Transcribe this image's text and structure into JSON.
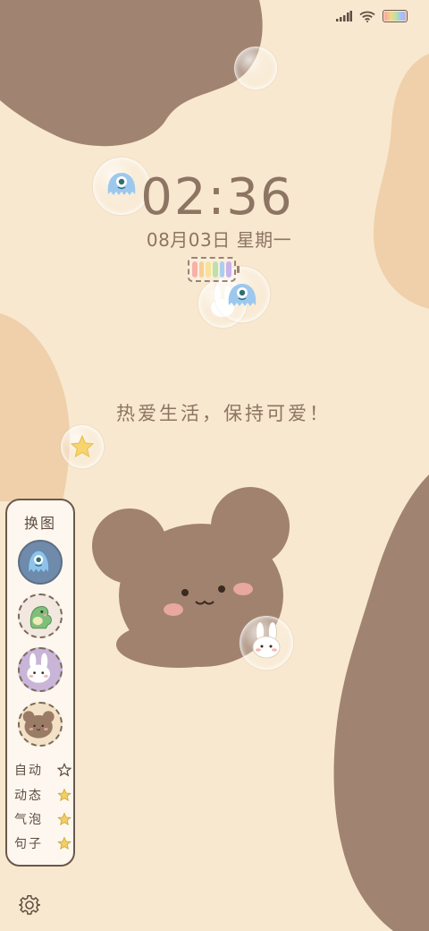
{
  "status_bar": {
    "signal_icon": "signal-bars-icon",
    "wifi_icon": "wifi-icon",
    "battery_icon": "rainbow-battery-icon"
  },
  "lockscreen": {
    "time": "02:36",
    "date": "08月03日 星期一",
    "slogan": "热爱生活，保持可爱！",
    "battery_widget_icon": "rainbow-battery-widget-icon"
  },
  "side_panel": {
    "title": "换图",
    "themes": [
      {
        "name": "monster",
        "icon": "blue-monster-icon"
      },
      {
        "name": "dinosaur",
        "icon": "green-dino-icon"
      },
      {
        "name": "bunny",
        "icon": "white-bunny-icon"
      },
      {
        "name": "bear",
        "icon": "brown-bear-icon"
      }
    ],
    "options": [
      {
        "label": "自动",
        "icon": "star-outline-icon"
      },
      {
        "label": "动态",
        "icon": "star-filled-icon"
      },
      {
        "label": "气泡",
        "icon": "star-filled-icon"
      },
      {
        "label": "句子",
        "icon": "star-filled-icon"
      }
    ]
  },
  "settings_icon": "gear-icon",
  "colors": {
    "background": "#f8e8cf",
    "brown_blob": "#a08370",
    "tan_blob": "#efd0aa",
    "text": "#8d7463",
    "bear": "#a0826e"
  }
}
